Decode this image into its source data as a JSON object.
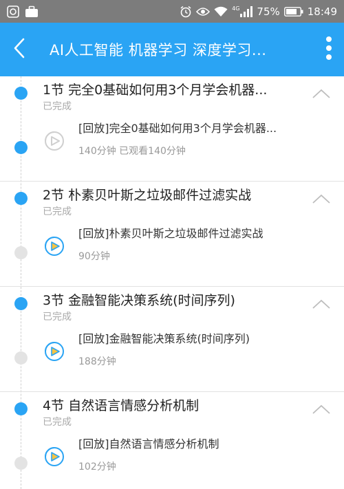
{
  "status_bar": {
    "network_badge": "4G",
    "battery_percent": "75%",
    "time": "18:49",
    "icons": [
      "app-notification-icon",
      "briefcase-icon",
      "alarm-icon",
      "eye-icon",
      "wifi-icon",
      "signal-icon",
      "battery-icon"
    ]
  },
  "header": {
    "title": "AI人工智能 机器学习 深度学习...",
    "back_icon": "chevron-left-icon",
    "more_icon": "more-vert-icon",
    "background": "#2aa4f4"
  },
  "colors": {
    "accent": "#2aa4f4",
    "inactive_dot": "#e3e3e3",
    "status_text": "#aaaaaa"
  },
  "sections": [
    {
      "chapter_title": "1节  完全0基础如何用3个月学会机器...",
      "chapter_status": "已完成",
      "lesson_title": "[回放]完全0基础如何用3个月学会机器...",
      "lesson_meta": "140分钟 已观看140分钟",
      "lesson_icon": "play-circle-watched-icon",
      "lesson_dot": "blue"
    },
    {
      "chapter_title": "2节  朴素贝叶斯之垃圾邮件过滤实战",
      "chapter_status": "已完成",
      "lesson_title": "[回放]朴素贝叶斯之垃圾邮件过滤实战",
      "lesson_meta": "90分钟",
      "lesson_icon": "play-circle-icon",
      "lesson_dot": "gray"
    },
    {
      "chapter_title": "3节  金融智能决策系统(时间序列)",
      "chapter_status": "已完成",
      "lesson_title": "[回放]金融智能决策系统(时间序列)",
      "lesson_meta": "188分钟",
      "lesson_icon": "play-circle-icon",
      "lesson_dot": "gray"
    },
    {
      "chapter_title": "4节  自然语言情感分析机制",
      "chapter_status": "已完成",
      "lesson_title": "[回放]自然语言情感分析机制",
      "lesson_meta": "102分钟",
      "lesson_icon": "play-circle-icon",
      "lesson_dot": "gray"
    }
  ]
}
